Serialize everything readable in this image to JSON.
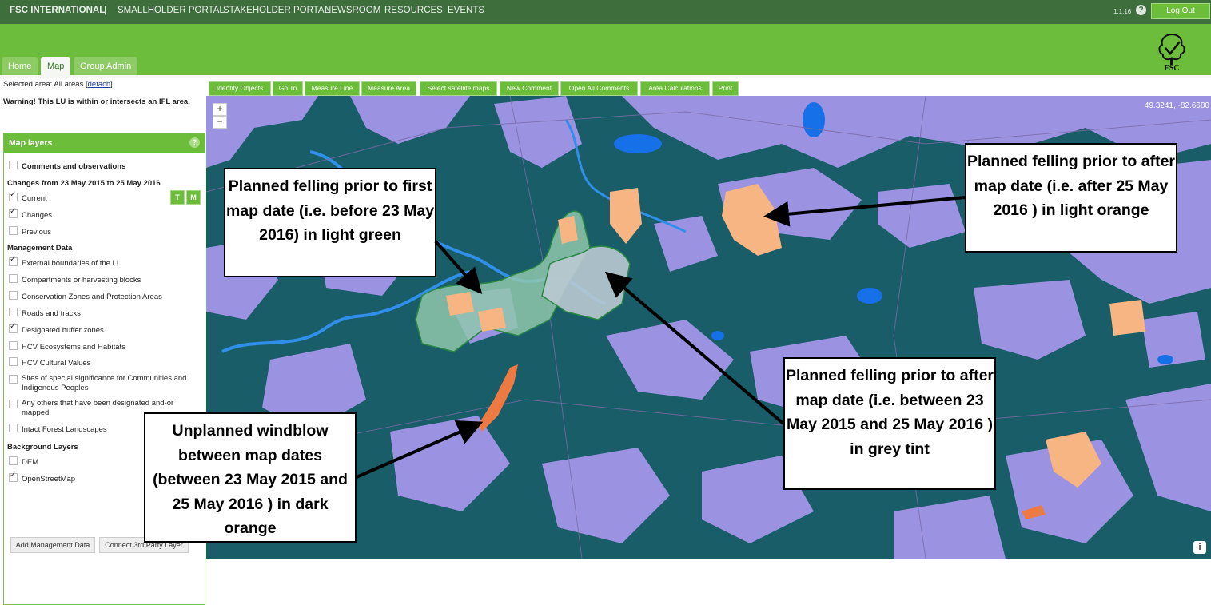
{
  "topnav": {
    "brand": "FSC INTERNATIONAL",
    "separator": "|",
    "links": [
      "SMALLHOLDER PORTAL",
      "STAKEHOLDER PORTAL",
      "NEWSROOM",
      "RESOURCES",
      "EVENTS"
    ],
    "version": "1.1.16",
    "help_icon": "question-circle",
    "logout_label": "Log Out"
  },
  "logo": {
    "text": "FSC",
    "icon": "fsc-tree-check-logo"
  },
  "tabs": [
    "Home",
    "Map",
    "Group Admin"
  ],
  "active_tab": "Map",
  "selected_area": {
    "label": "Selected area: All areas",
    "detach_link": "detach"
  },
  "warning": "Warning! This LU is within or intersects an IFL area.",
  "layers_panel": {
    "title": "Map layers",
    "comments_label": "Comments and observations",
    "changes_heading": "Changes from 23 May 2015 to 25 May 2016",
    "changes_items": [
      {
        "label": "Current",
        "checked": true
      },
      {
        "label": "Changes",
        "checked": true
      },
      {
        "label": "Previous",
        "checked": false
      }
    ],
    "t_button": "T",
    "m_button": "M",
    "management_heading": "Management Data",
    "management_items": [
      {
        "label": "External boundaries of the LU",
        "checked": true
      },
      {
        "label": "Compartments or harvesting blocks",
        "checked": false
      },
      {
        "label": "Conservation Zones and Protection Areas",
        "checked": false
      },
      {
        "label": "Roads and tracks",
        "checked": false
      },
      {
        "label": "Designated buffer zones",
        "checked": true
      },
      {
        "label": "HCV Ecosystems and Habitats",
        "checked": false
      },
      {
        "label": "HCV Cultural Values",
        "checked": false
      },
      {
        "label": "Sites of special significance for Communities and Indigenous Peoples",
        "checked": false
      },
      {
        "label": "Any others that have been designated and-or mapped",
        "checked": false
      },
      {
        "label": "Intact Forest Landscapes",
        "checked": false
      }
    ],
    "background_heading": "Background Layers",
    "background_items": [
      {
        "label": "DEM",
        "checked": false
      },
      {
        "label": "OpenStreetMap",
        "checked": true
      }
    ],
    "add_management_button": "Add Management Data",
    "connect_button": "Connect 3rd Party Layer"
  },
  "toolbar": [
    "Identify Objects",
    "Go To",
    "Measure Line",
    "Measure Area",
    "Select satellite maps",
    "New Comment",
    "Open All Comments",
    "Area Calculations",
    "Print"
  ],
  "map": {
    "coordinates": "49.3241, -82.6680",
    "zoom_in": "+",
    "zoom_out": "−",
    "info_label": "i",
    "colors": {
      "forest": "#195d68",
      "clearing": "#9b93e2",
      "water": "#1670e8",
      "light_green": "#8fc7ad",
      "light_orange": "#f6b583",
      "grey_tint": "#b9c9d1",
      "dark_orange": "#ee7a43"
    }
  },
  "callouts": {
    "light_green": "Planned felling prior to first map date (i.e. before 23 May 2016) in light green",
    "light_orange": "Planned felling prior to after map date (i.e. after 25 May 2016 ) in light orange",
    "grey_tint": "Planned felling prior to after map date (i.e. between 23 May 2015 and 25 May 2016 ) in grey tint",
    "dark_orange": "Unplanned windblow between map dates (between 23 May 2015 and 25 May 2016 ) in dark orange"
  }
}
